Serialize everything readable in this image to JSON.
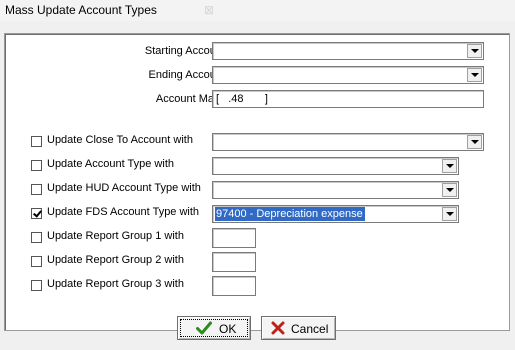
{
  "window": {
    "title": "Mass Update Account Types"
  },
  "form": {
    "starting_account": {
      "label": "Starting Account",
      "value": ""
    },
    "ending_account": {
      "label": "Ending Account",
      "value": ""
    },
    "account_mask": {
      "label": "Account Mask",
      "value": "[   .48       ]"
    }
  },
  "updates": [
    {
      "label": "Update Close To Account with",
      "checked": false,
      "value": ""
    },
    {
      "label": "Update Account Type with",
      "checked": false,
      "value": ""
    },
    {
      "label": "Update HUD Account Type with",
      "checked": false,
      "value": ""
    },
    {
      "label": "Update FDS Account Type with",
      "checked": true,
      "value": "97400 - Depreciation expense"
    },
    {
      "label": "Update Report Group 1 with",
      "checked": false,
      "value": ""
    },
    {
      "label": "Update Report Group 2 with",
      "checked": false,
      "value": ""
    },
    {
      "label": "Update Report Group 3 with",
      "checked": false,
      "value": ""
    }
  ],
  "buttons": {
    "ok_label": "OK",
    "cancel_label": "Cancel"
  },
  "colors": {
    "selection": "#316ac5",
    "ok_check": "#2e8b1e",
    "cancel_x": "#c0201a"
  },
  "icons": {
    "ok": "check-icon",
    "cancel": "x-icon"
  }
}
